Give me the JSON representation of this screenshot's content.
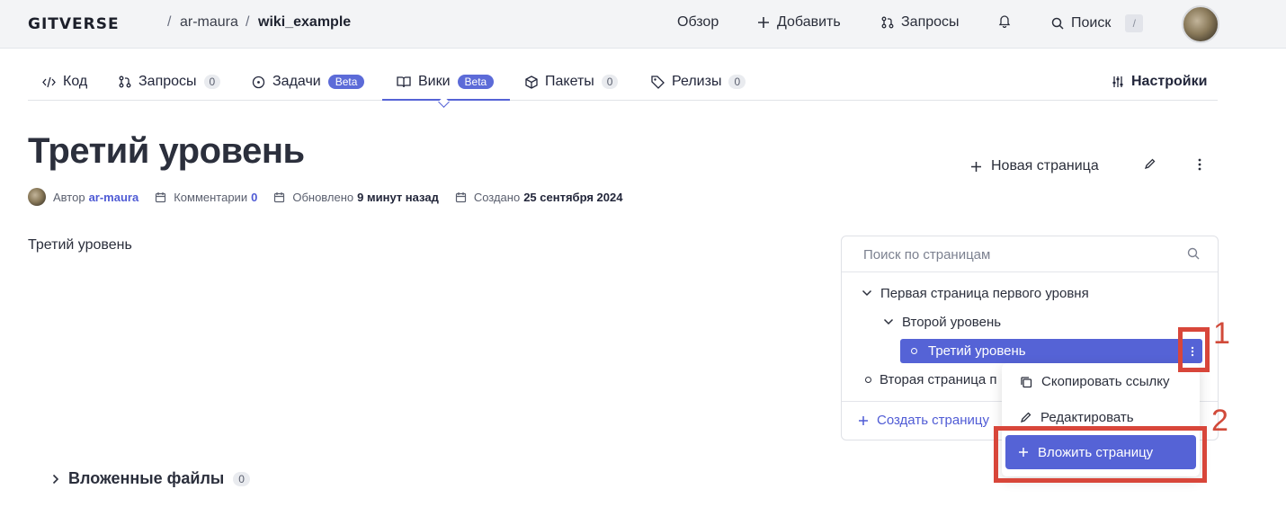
{
  "header": {
    "logo": "GITVERSE",
    "breadcrumb": {
      "sep": "/",
      "owner": "ar-maura",
      "repo": "wiki_example"
    },
    "nav": {
      "overview": "Обзор",
      "add": "Добавить",
      "requests": "Запросы",
      "search": "Поиск",
      "search_kbd": "/"
    }
  },
  "tabs": {
    "code": "Код",
    "requests": "Запросы",
    "requests_count": "0",
    "tasks": "Задачи",
    "tasks_badge": "Beta",
    "wiki": "Вики",
    "wiki_badge": "Beta",
    "packages": "Пакеты",
    "packages_count": "0",
    "releases": "Релизы",
    "releases_count": "0",
    "settings": "Настройки"
  },
  "page": {
    "title": "Третий уровень",
    "new_page": "Новая страница",
    "meta": {
      "author_label": "Автор",
      "author": "ar-maura",
      "comments_label": "Комментарии",
      "comments": "0",
      "updated_label": "Обновлено",
      "updated": "9 минут назад",
      "created_label": "Создано",
      "created": "25 сентября 2024"
    },
    "body": "Третий уровень"
  },
  "sidebar": {
    "search_placeholder": "Поиск по страницам",
    "tree": {
      "item1": "Первая страница первого уровня",
      "item2": "Второй уровень",
      "item3": "Третий уровень",
      "item4": "Вторая страница п"
    },
    "create": "Создать страницу"
  },
  "context_menu": {
    "copy_link": "Скопировать ссылку",
    "edit": "Редактировать",
    "nest_page": "Вложить страницу"
  },
  "annotations": {
    "one": "1",
    "two": "2"
  },
  "attachments": {
    "label": "Вложенные файлы",
    "count": "0"
  }
}
